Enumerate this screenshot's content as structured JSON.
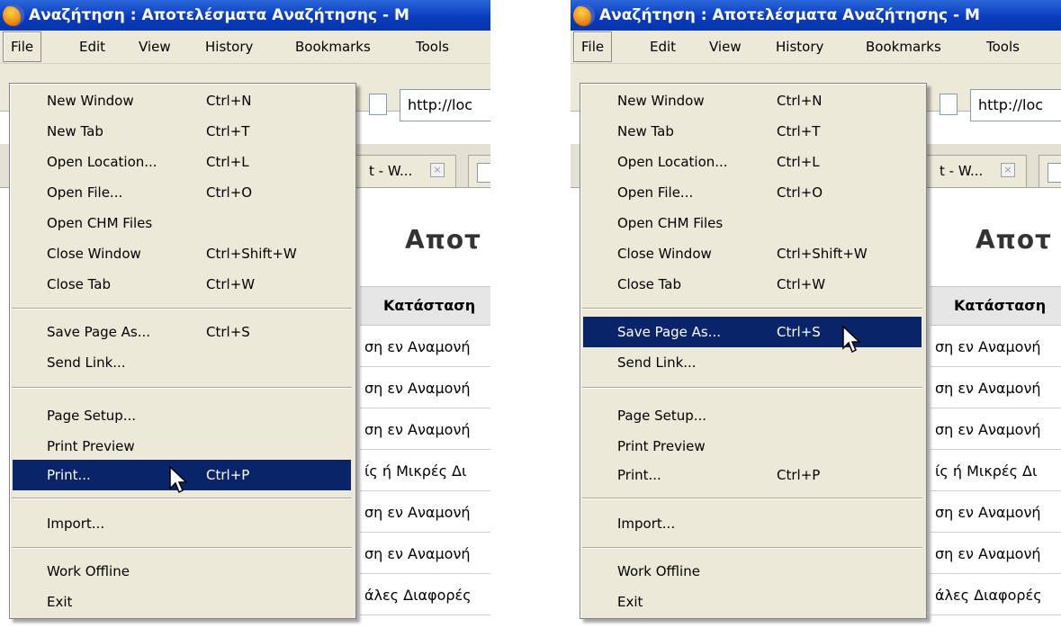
{
  "window": {
    "title": "Αναζήτηση : Αποτελέσματα Αναζήτησης - Μ"
  },
  "menubar": [
    "File",
    "Edit",
    "View",
    "History",
    "Bookmarks",
    "Tools"
  ],
  "address": {
    "url": "http://loc"
  },
  "tabs": [
    {
      "label": "t - W..."
    }
  ],
  "page": {
    "heading": "Αποτ",
    "column_header": "Κατάσταση",
    "rows": [
      "ση εν Αναμονή",
      "ση εν Αναμονή",
      "ση εν Αναμονή",
      "ίς ή Μικρές Δι",
      "ση εν Αναμονή",
      "ση εν Αναμονή",
      "άλες Διαφορές"
    ]
  },
  "file_menu": [
    {
      "label": "New Window",
      "shortcut": "Ctrl+N"
    },
    {
      "label": "New Tab",
      "shortcut": "Ctrl+T"
    },
    {
      "label": "Open Location...",
      "shortcut": "Ctrl+L"
    },
    {
      "label": "Open File...",
      "shortcut": "Ctrl+O"
    },
    {
      "label": "Open CHM Files",
      "shortcut": ""
    },
    {
      "label": "Close Window",
      "shortcut": "Ctrl+Shift+W"
    },
    {
      "label": "Close Tab",
      "shortcut": "Ctrl+W"
    },
    {
      "label": "Save Page As...",
      "shortcut": "Ctrl+S"
    },
    {
      "label": "Send Link...",
      "shortcut": ""
    },
    {
      "label": "Page Setup...",
      "shortcut": ""
    },
    {
      "label": "Print Preview",
      "shortcut": ""
    },
    {
      "label": "Print...",
      "shortcut": "Ctrl+P"
    },
    {
      "label": "Import...",
      "shortcut": ""
    },
    {
      "label": "Work Offline",
      "shortcut": ""
    },
    {
      "label": "Exit",
      "shortcut": ""
    }
  ],
  "screens": [
    {
      "highlighted_item": "Print..."
    },
    {
      "highlighted_item": "Save Page As..."
    }
  ],
  "colors": {
    "titlebar": "#0a3cc0",
    "highlight": "#0a246a",
    "menu_bg": "#ece9d8"
  }
}
